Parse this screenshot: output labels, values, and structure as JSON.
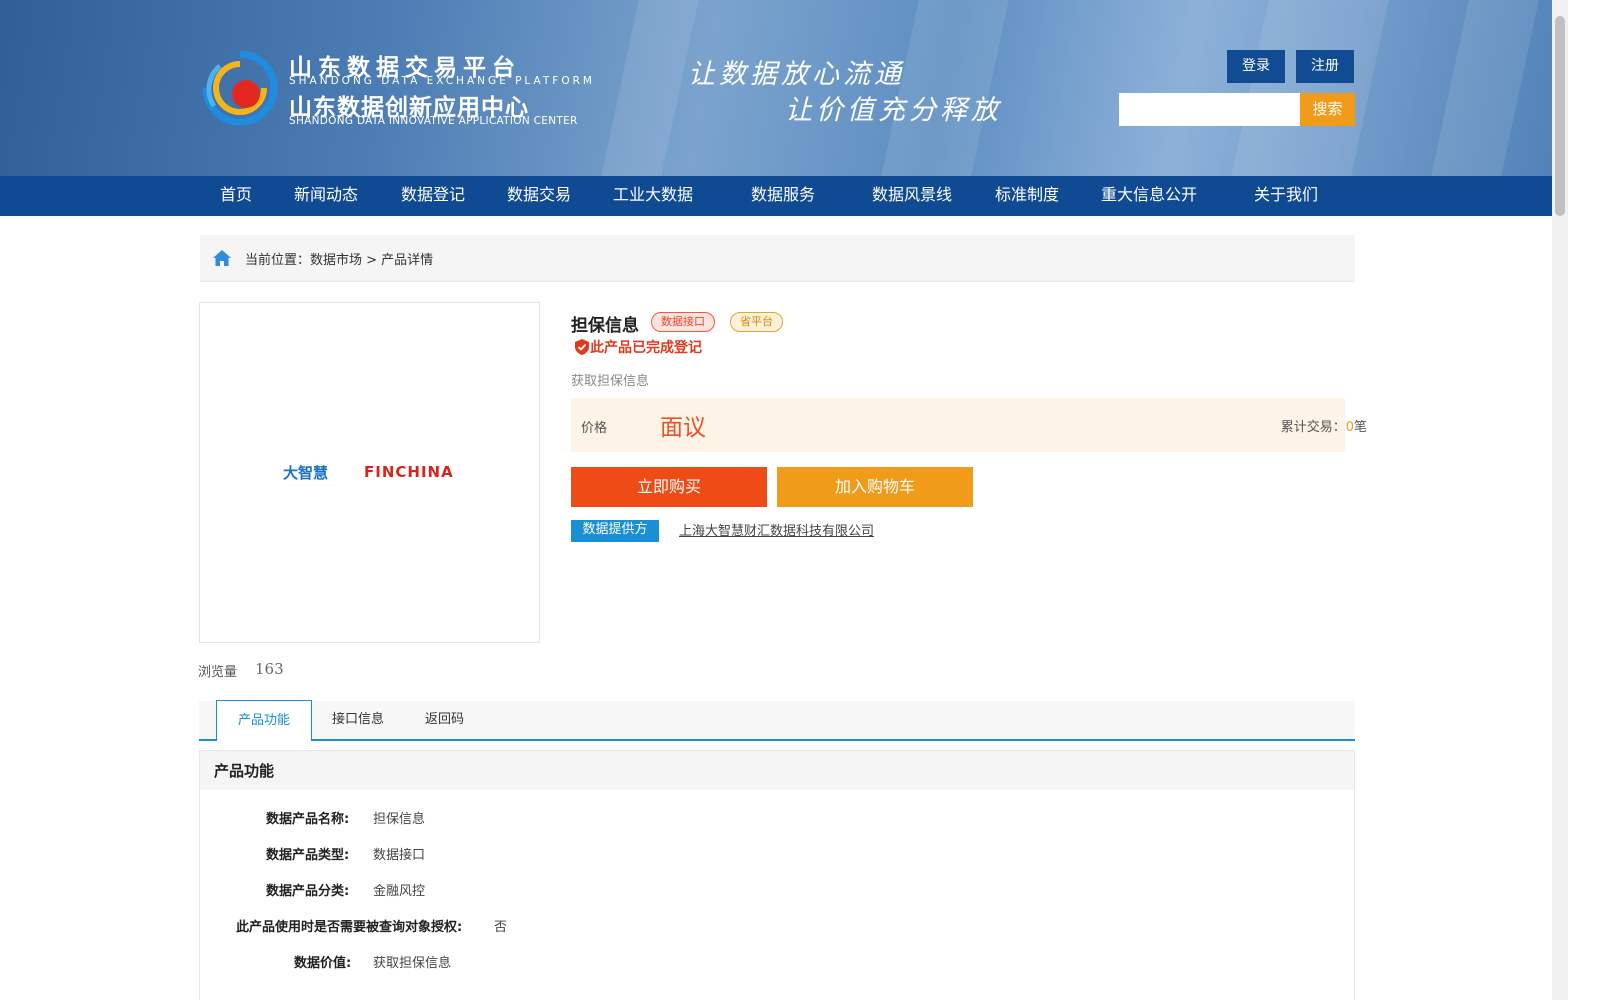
{
  "header": {
    "logo_cn_1": "山东数据交易平台",
    "logo_en_1": "SHANDONG DATA EXCHANGE PLATFORM",
    "logo_cn_2": "山东数据创新应用中心",
    "logo_en_2": "SHANDONG DATA INNOVATIVE APPLICATION CENTER",
    "slogan_1": "让数据放心流通",
    "slogan_2": "让价值充分释放",
    "login_label": "登录",
    "register_label": "注册",
    "search_placeholder": "",
    "search_label": "搜索"
  },
  "nav": [
    {
      "label": "首页"
    },
    {
      "label": "新闻动态"
    },
    {
      "label": "数据登记"
    },
    {
      "label": "数据交易"
    },
    {
      "label": "工业大数据"
    },
    {
      "label": "数据服务"
    },
    {
      "label": "数据风景线"
    },
    {
      "label": "标准制度"
    },
    {
      "label": "重大信息公开"
    },
    {
      "label": "关于我们"
    }
  ],
  "breadcrumb": {
    "prefix": "当前位置：",
    "path": "数据市场 > 产品详情"
  },
  "product": {
    "image_logo_1": "大智慧",
    "image_logo_2": "FINCHINA",
    "views_label": "浏览量",
    "views_value": "163",
    "title": "担保信息",
    "tag_type": "数据接口",
    "tag_platform": "省平台",
    "registered_text": "此产品已完成登记",
    "description": "获取担保信息",
    "price_label": "价格",
    "price_value": "面议",
    "trade_label": "累计交易：",
    "trade_count": "0",
    "trade_unit": "笔",
    "buy_label": "立即购买",
    "cart_label": "加入购物车",
    "provider_label": "数据提供方",
    "provider_name": "上海大智慧财汇数据科技有限公司"
  },
  "tabs": [
    {
      "label": "产品功能",
      "active": true
    },
    {
      "label": "接口信息",
      "active": false
    },
    {
      "label": "返回码",
      "active": false
    }
  ],
  "details": {
    "title": "产品功能",
    "rows": [
      {
        "label": "数据产品名称:",
        "value": "担保信息"
      },
      {
        "label": "数据产品类型:",
        "value": "数据接口"
      },
      {
        "label": "数据产品分类:",
        "value": "金融风控"
      },
      {
        "label": "此产品使用时是否需要被查询对象授权:",
        "value": "否"
      },
      {
        "label": "数据价值:",
        "value": "获取担保信息"
      }
    ]
  },
  "colors": {
    "nav_bg": "#104a92",
    "accent_orange": "#f19b1b",
    "buy_red": "#ef4b17",
    "tab_blue": "#1a8fd6"
  }
}
